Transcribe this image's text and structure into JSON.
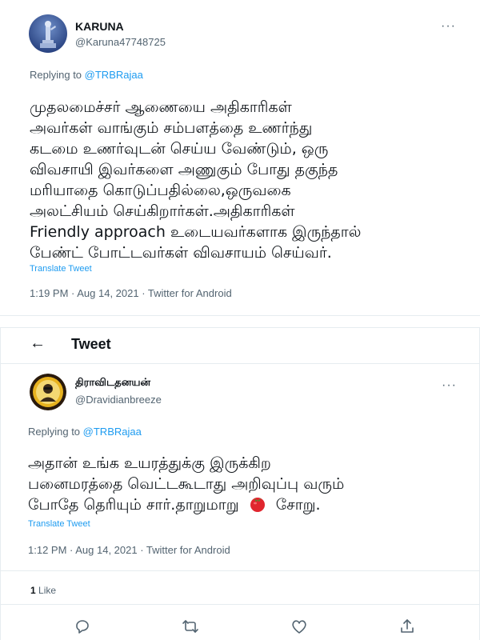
{
  "tweet1": {
    "display_name": "KARUNA",
    "handle": "@Karuna47748725",
    "replying_prefix": "Replying to",
    "replying_to": "@TRBRajaa",
    "lines": [
      "முதலமைச்சர் ஆணையை அதிகாரிகள்",
      "அவர்கள் வாங்கும் சம்பளத்தை உணர்ந்து",
      "கடமை உணர்வுடன் செய்ய வேண்டும், ஒரு",
      "விவசாயி இவர்களை அணுகும் போது தகுந்த",
      "மரியாதை கொடுப்பதில்லை,ஒருவகை",
      "அலட்சியம் செய்கிறார்கள்.அதிகாரிகள்",
      "Friendly approach உடையவர்களாக இருந்தால்",
      "பேண்ட் போட்டவர்கள் விவசாயம் செய்வர்."
    ],
    "translate_label": "Translate Tweet",
    "timestamp": "1:19 PM · Aug 14, 2021 · Twitter for Android",
    "more_label": "···"
  },
  "tweet2": {
    "header_title": "Tweet",
    "back_label": "←",
    "display_name": "திராவிடதனயன்",
    "handle": "@Dravidianbreeze",
    "replying_prefix": "Replying to",
    "replying_to": "@TRBRajaa",
    "lines": [
      "அதான் உங்க உயரத்துக்கு இருக்கிற",
      "பனைமரத்தை வெட்டகூடாது அறிவுப்பு வரும்",
      "போதே தெரியும் சார்.தாறுமாறு",
      "சோறு."
    ],
    "translate_label": "Translate Tweet",
    "timestamp": "1:12 PM · Aug 14, 2021 · Twitter for Android",
    "likes_count": "1",
    "likes_label": "Like",
    "more_label": "···"
  },
  "colors": {
    "link": "#1d9bf0",
    "secondary_text": "#536471",
    "divider": "#e6ecf0"
  }
}
